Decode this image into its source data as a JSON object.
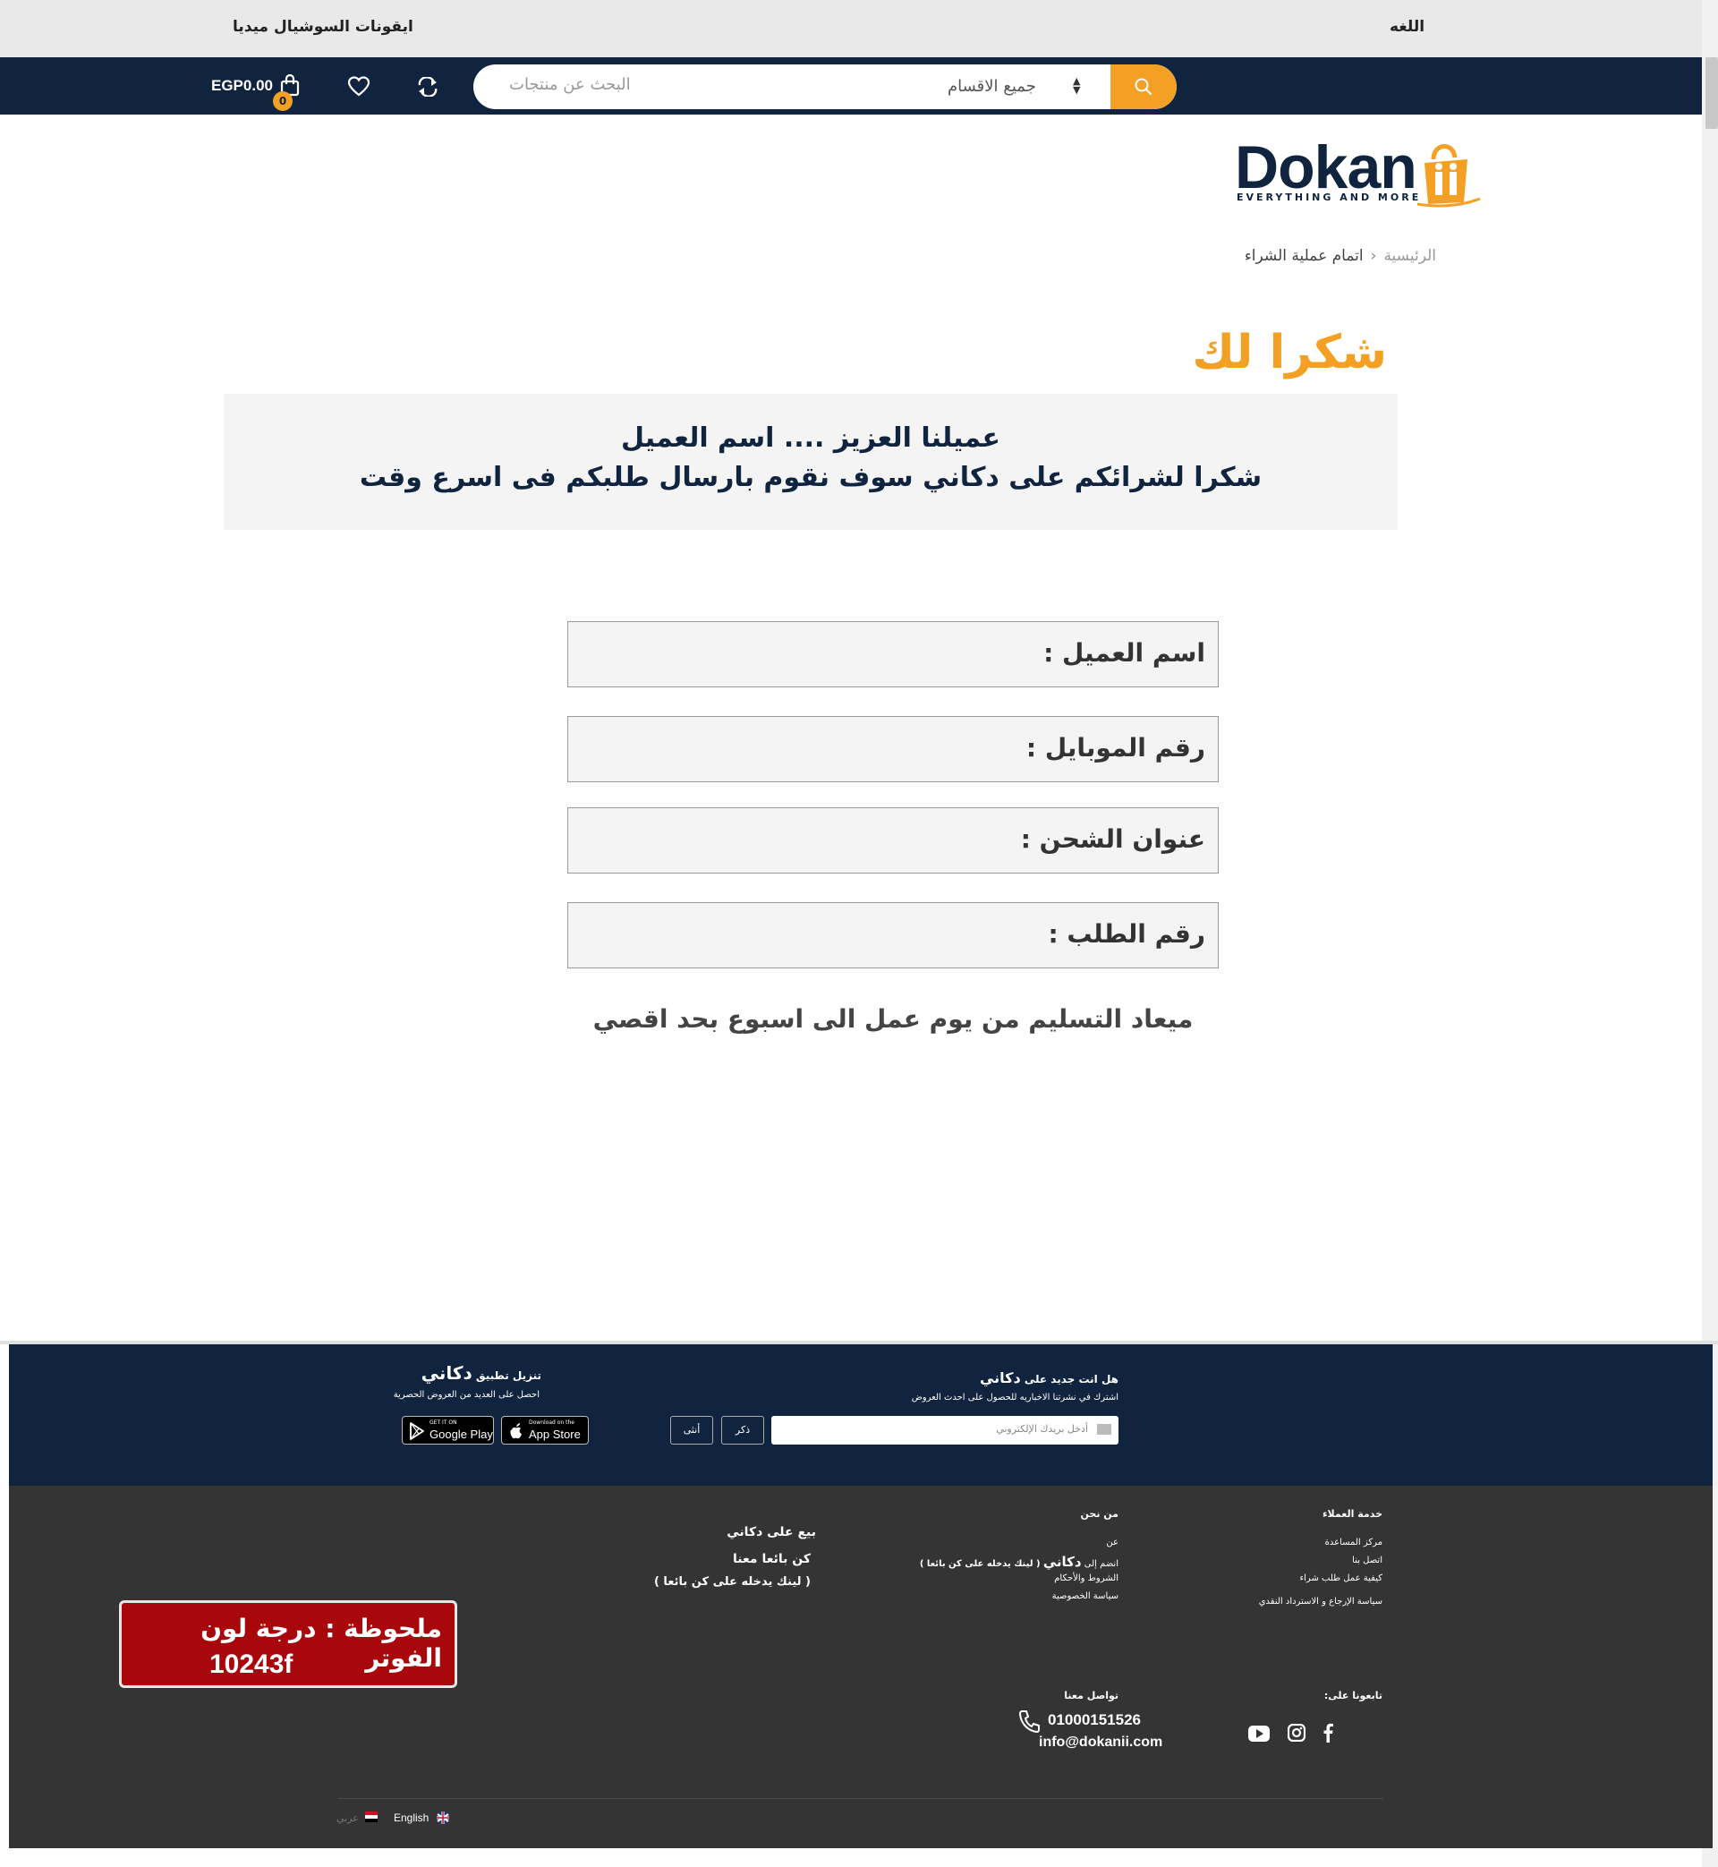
{
  "topbar": {
    "language_label": "اللغه",
    "social_label": "ايقونات السوشيال ميديا"
  },
  "navbar": {
    "category_select": "جميع الاقسام",
    "search_placeholder": "البحث عن منتجات",
    "cart_total": "EGP0.00",
    "cart_count": "0",
    "colors": {
      "navy": "#10243f",
      "accent": "#f4a025"
    },
    "icons": [
      "search-icon",
      "compare-icon",
      "heart-icon",
      "cart-icon"
    ]
  },
  "logo": {
    "word": "Dokan",
    "tagline": "EVERYTHING AND MORE"
  },
  "breadcrumb": {
    "home": "الرئيسية",
    "separator": "‹",
    "current": "اتمام عملية الشراء"
  },
  "thanks": {
    "title": "شكرا لك",
    "line1": "عميلنا العزيز .... اسم العميل",
    "line2": "شكرا لشرائكم على دكاني سوف نقوم بارسال طلبكم فى اسرع وقت"
  },
  "fields": {
    "customer_name": "اسم العميل :",
    "mobile": "رقم الموبايل :",
    "shipping_address": "عنوان الشحن :",
    "order_number": "رقم الطلب :"
  },
  "delivery_note": "ميعاد التسليم من يوم عمل الى اسبوع بحد اقصي",
  "footer": {
    "newsletter": {
      "title_prefix": "هل انت جديد على",
      "brand": "دكاني",
      "subtitle": "اشترك في نشرتنا الاخباريه للحصول على احدث العروض",
      "placeholder": "أدخل بريدك الإلكتروني",
      "male_button": "ذكر",
      "female_button": "أنثى"
    },
    "app": {
      "title_prefix": "تنزيل تطبيق",
      "brand": "دكاني",
      "subtitle": "احصل على العديد من العروض الحصرية",
      "google_small": "GET IT ON",
      "google_big": "Google Play",
      "apple_small": "Download on the",
      "apple_big": "App Store"
    },
    "customer_service": {
      "title": "خدمة العملاء",
      "links": [
        "مركز المساعدة",
        "اتصل بنا",
        "كيفية عمل طلب شراء",
        "سياسة الإرجاع و الاسترداد النقدي"
      ]
    },
    "about": {
      "title": "من نحن",
      "links": [
        "عن",
        "انضم إلى",
        "الشروط والأحكام",
        "سياسة الخصوصية"
      ],
      "join_brand": "دكاني",
      "join_note": "( لينك يدخله على كن بائعا )"
    },
    "sell": {
      "title": "بيع على دكاني",
      "become_seller": "كن بائعا معنا",
      "note": "( لينك يدخله على كن بائعا )"
    },
    "follow": {
      "title": "تابعونا على:",
      "icons": [
        "youtube-icon",
        "instagram-icon",
        "facebook-icon"
      ]
    },
    "contact": {
      "title": "تواصل معنا",
      "phone": "01000151526",
      "email": "info@dokanii.com"
    },
    "designer_note": {
      "line1": "ملحوظة : درجة لون الفوتر",
      "line2": "10243f"
    },
    "languages": {
      "english": "English",
      "arabic": "عربي"
    }
  }
}
